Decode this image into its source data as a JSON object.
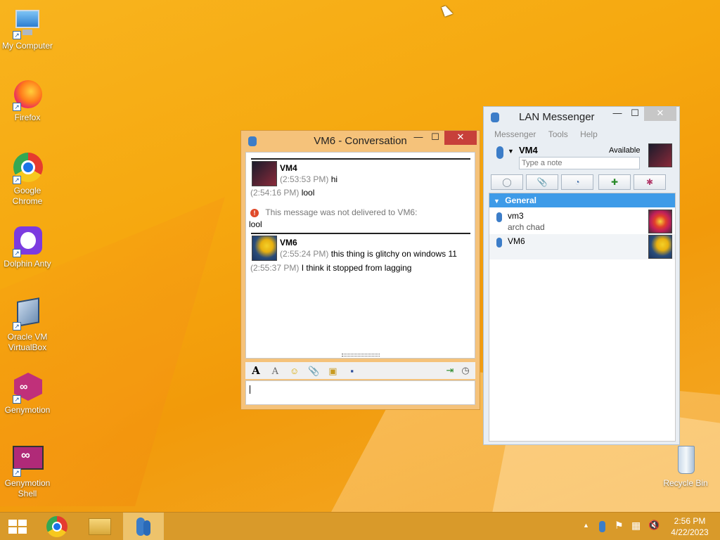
{
  "desktop": {
    "icons": [
      {
        "label": "My Computer"
      },
      {
        "label": "Firefox"
      },
      {
        "label": "Google Chrome"
      },
      {
        "label": "Dolphin Anty"
      },
      {
        "label": "Oracle VM VirtualBox"
      },
      {
        "label": "Genymotion"
      },
      {
        "label": "Genymotion Shell"
      },
      {
        "label": "Recycle Bin"
      }
    ]
  },
  "conversation": {
    "title": "VM6 - Conversation",
    "messages": [
      {
        "sender": "VM4",
        "ts1": "(2:53:53 PM)",
        "text1": "hi",
        "ts2": "(2:54:16 PM)",
        "text2": "lool"
      },
      {
        "error": "This message was not delivered to VM6:",
        "error_text": "lool"
      },
      {
        "sender": "VM6",
        "ts1": "(2:55:24 PM)",
        "text1": "this thing is glitchy on windows 11",
        "ts2": "(2:55:37 PM)",
        "text2": "I think it stopped from lagging"
      }
    ],
    "input_value": ""
  },
  "lan": {
    "title": "LAN Messenger",
    "menu": [
      "Messenger",
      "Tools",
      "Help"
    ],
    "user_name": "VM4",
    "status": "Available",
    "note_placeholder": "Type a note",
    "group": "General",
    "contacts": [
      {
        "name": "vm3",
        "note": "arch chad"
      },
      {
        "name": "VM6",
        "note": ""
      }
    ]
  },
  "taskbar": {
    "time": "2:56 PM",
    "date": "4/22/2023"
  },
  "colors": {
    "accent": "#3e9be8",
    "close": "#c7403a",
    "error": "#e04a2a"
  }
}
